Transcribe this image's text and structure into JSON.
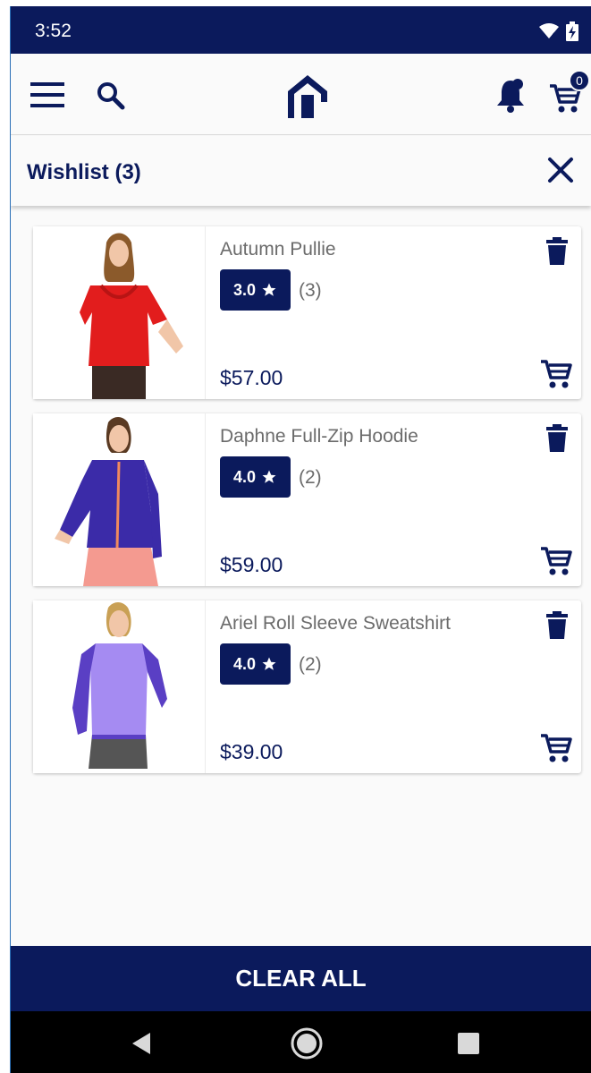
{
  "status_bar": {
    "time": "3:52",
    "signal_label": "4"
  },
  "app_bar": {
    "cart_count": "0"
  },
  "wishlist": {
    "title": "Wishlist (3)"
  },
  "items": [
    {
      "name": "Autumn Pullie",
      "rating": "3.0",
      "reviews": "(3)",
      "price": "$57.00",
      "color": "#e21d1d"
    },
    {
      "name": "Daphne Full-Zip Hoodie",
      "rating": "4.0",
      "reviews": "(2)",
      "price": "$59.00",
      "color": "#3b2ba8"
    },
    {
      "name": "Ariel Roll Sleeve Sweatshirt",
      "rating": "4.0",
      "reviews": "(2)",
      "price": "$39.00",
      "color": "#5a3fc4"
    }
  ],
  "footer": {
    "clear_all_label": "CLEAR ALL"
  },
  "colors": {
    "primary": "#0b1a5c",
    "background": "#fafafa"
  }
}
